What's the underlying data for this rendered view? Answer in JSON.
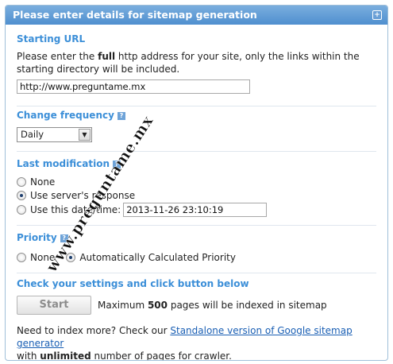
{
  "header": {
    "title": "Please enter details for sitemap generation",
    "collapse_icon": "collapse-icon"
  },
  "starting_url": {
    "title": "Starting URL",
    "desc_pre": "Please enter the ",
    "desc_bold": "full",
    "desc_post": " http address for your site, only the links within the starting directory will be included.",
    "value": "http://www.preguntame.mx"
  },
  "change_frequency": {
    "title": "Change frequency",
    "help_label": "?",
    "selected": "Daily",
    "arrow": "▼"
  },
  "last_modification": {
    "title": "Last modification",
    "help_label": "?",
    "options": [
      "None",
      "Use server's response",
      "Use this date/time:"
    ],
    "selected_index": 1,
    "datetime": "2013-11-26 23:10:19"
  },
  "priority": {
    "title": "Priority",
    "help_label": "?",
    "options": [
      "None",
      "Automatically Calculated Priority"
    ],
    "selected_index": 1
  },
  "check": {
    "title": "Check your settings and click button below",
    "start_label": "Start",
    "max_pre": "Maximum ",
    "max_num": "500",
    "max_post": " pages will be indexed in sitemap"
  },
  "footer": {
    "pre": "Need to index more? Check our ",
    "link": "Standalone version of Google sitemap generator",
    "line2_pre": "with ",
    "line2_bold": "unlimited",
    "line2_post": " number of pages for crawler."
  },
  "watermark": "www.preguntame.mx",
  "colors": {
    "header_bg": "#5b97d3",
    "section_title": "#3c8fd8",
    "link": "#1a5fb4"
  }
}
